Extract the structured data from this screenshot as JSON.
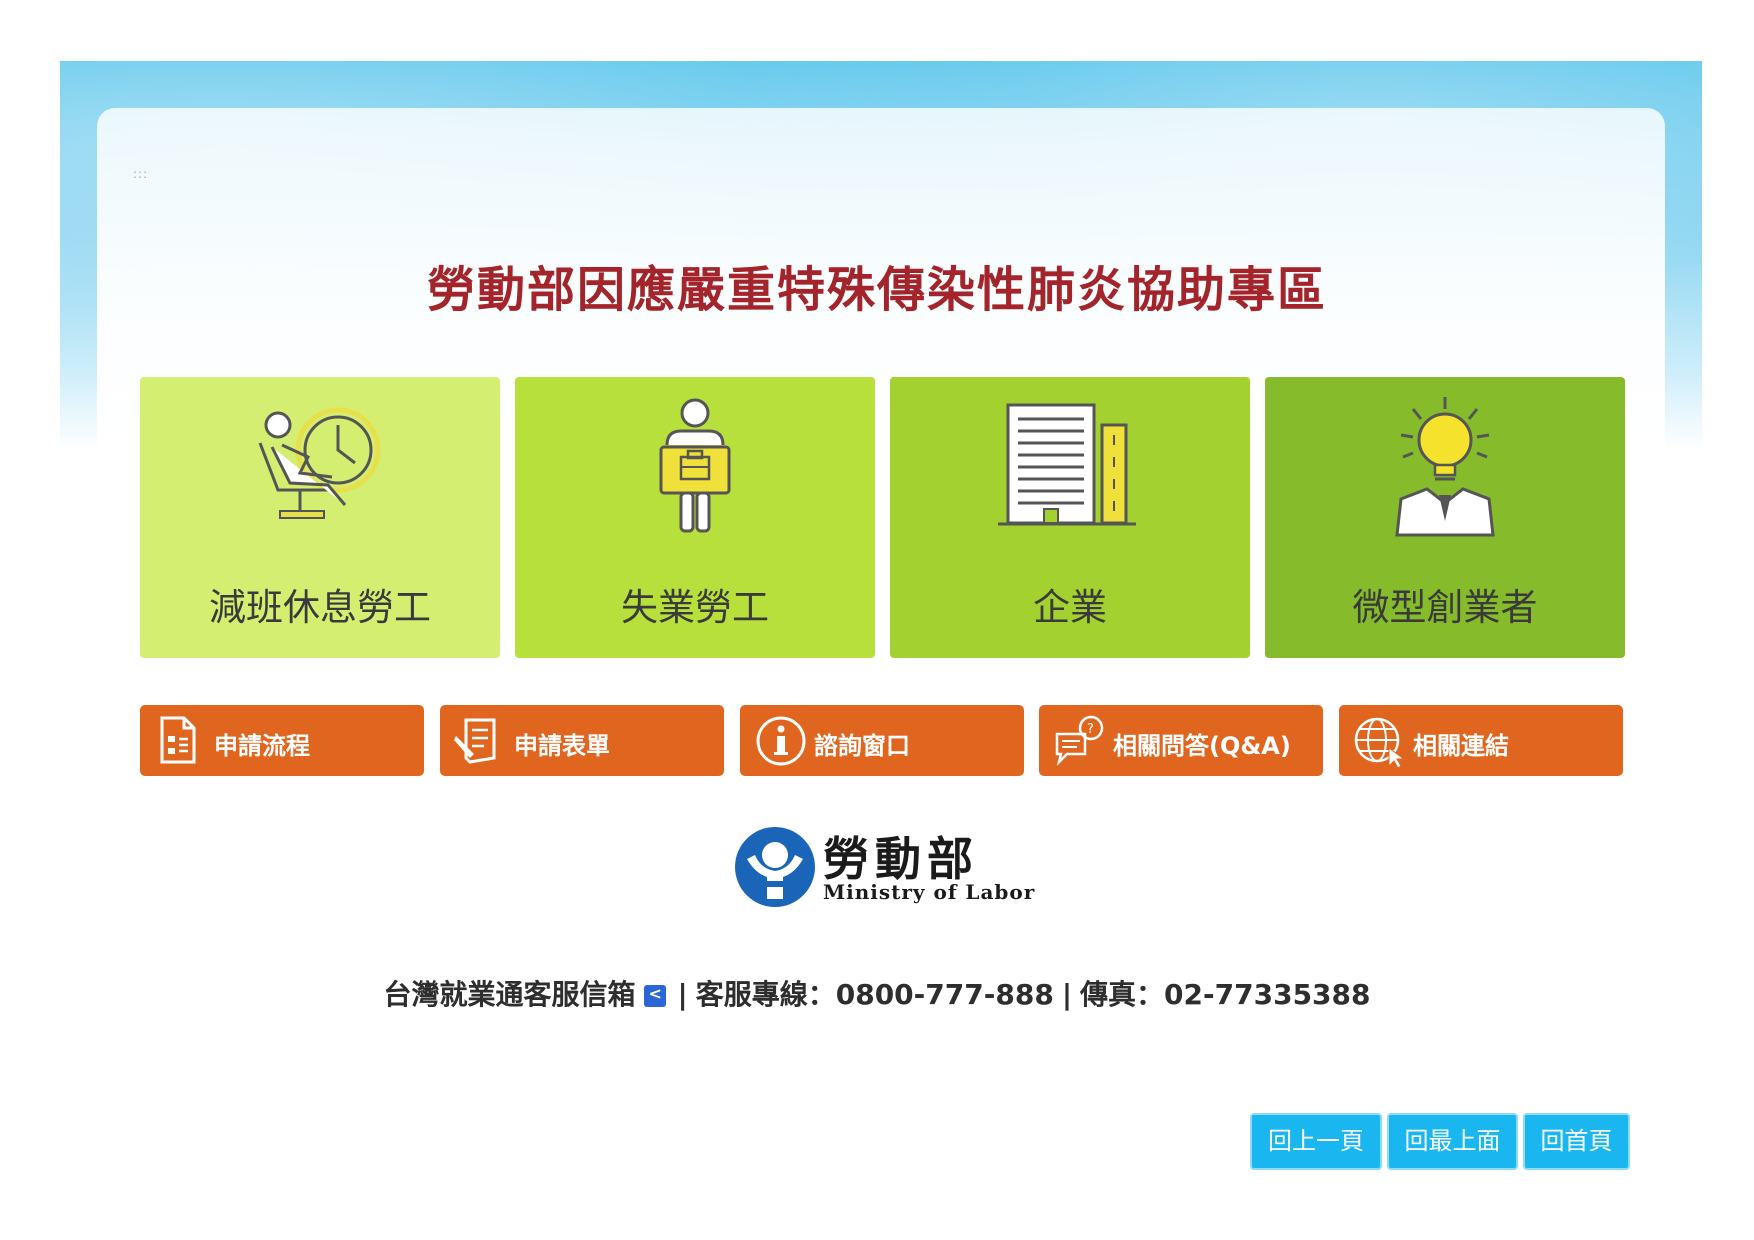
{
  "page": {
    "title": "勞動部因應嚴重特殊傳染性肺炎協助專區",
    "dots": ":::"
  },
  "categories": [
    {
      "label": "減班休息勞工",
      "icon": "reclining-worker-clock-icon"
    },
    {
      "label": "失業勞工",
      "icon": "worker-with-briefcase-icon"
    },
    {
      "label": "企業",
      "icon": "office-building-icon"
    },
    {
      "label": "微型創業者",
      "icon": "lightbulb-entrepreneur-icon"
    }
  ],
  "actions": [
    {
      "label": "申請流程",
      "icon": "document-flow-icon"
    },
    {
      "label": "申請表單",
      "icon": "form-pen-icon"
    },
    {
      "label": "諮詢窗口",
      "icon": "info-icon"
    },
    {
      "label": "相關問答(Q&A)",
      "icon": "chat-question-icon"
    },
    {
      "label": "相關連結",
      "icon": "globe-cursor-icon"
    }
  ],
  "logo": {
    "cn": "勞動部",
    "en": "Ministry  of  Labor"
  },
  "contact": {
    "mailbox": "台灣就業通客服信箱",
    "sep": "|",
    "hotline": "客服專線：0800-777-888",
    "fax": "傳真：02-77335388"
  },
  "nav": {
    "back": "回上一頁",
    "top": "回最上面",
    "home": "回首頁"
  },
  "colors": {
    "title": "#a3242b",
    "card1": "#d4ee72",
    "card2": "#b8e03d",
    "card3": "#a3d230",
    "card4": "#86bb2b",
    "action": "#e0661f",
    "nav": "#1ab6ef"
  }
}
